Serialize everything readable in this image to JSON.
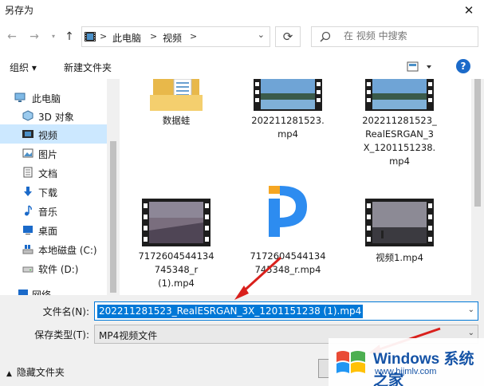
{
  "window": {
    "title": "另存为",
    "close_glyph": "✕"
  },
  "nav": {
    "back_glyph": "←",
    "forward_glyph": "→",
    "recent_glyph": "▾",
    "up_glyph": "↑",
    "breadcrumb": [
      "此电脑",
      "视频"
    ],
    "breadcrumb_sep": ">",
    "search_placeholder": "在 视频 中搜索"
  },
  "toolbar": {
    "organize": "组织 ▾",
    "new_folder": "新建文件夹",
    "help": "?"
  },
  "sidebar": {
    "items": [
      {
        "label": "此电脑",
        "icon": "computer-icon"
      },
      {
        "label": "3D 对象",
        "icon": "3d-objects-icon"
      },
      {
        "label": "视频",
        "icon": "video-icon",
        "selected": true
      },
      {
        "label": "图片",
        "icon": "pictures-icon"
      },
      {
        "label": "文档",
        "icon": "documents-icon"
      },
      {
        "label": "下载",
        "icon": "download-icon"
      },
      {
        "label": "音乐",
        "icon": "music-icon"
      },
      {
        "label": "桌面",
        "icon": "desktop-icon"
      },
      {
        "label": "本地磁盘 (C:)",
        "icon": "windows-drive-icon"
      },
      {
        "label": "软件 (D:)",
        "icon": "drive-icon"
      },
      {
        "label": "网络",
        "icon": "network-icon"
      }
    ]
  },
  "files": [
    {
      "name": "数据蛙",
      "kind": "folder"
    },
    {
      "name": "202211281523.\nmp4",
      "kind": "video-lake"
    },
    {
      "name": "202211281523_\nRealESRGAN_3\nX_1201151238.\nmp4",
      "kind": "video-lake"
    },
    {
      "name": "7172604544134\n745348_r\n(1).mp4",
      "kind": "video-sky"
    },
    {
      "name": "7172604544134\n745348_r.mp4",
      "kind": "app-logo"
    },
    {
      "name": "视频1.mp4",
      "kind": "video-dusk"
    }
  ],
  "form": {
    "filename_label": "文件名(N):",
    "filename_value": "202211281523_RealESRGAN_3X_1201151238 (1).mp4",
    "filetype_label": "保存类型(T):",
    "filetype_value": "MP4视频文件"
  },
  "footer": {
    "hide_folders": "隐藏文件夹"
  },
  "watermark": {
    "brand": "Windows 系统之家",
    "site": "www.bjjmlv.com"
  },
  "colors": {
    "accent": "#0078d7",
    "selected": "#cce8ff",
    "arrow": "#d9201c",
    "watermark": "#1553a6"
  }
}
